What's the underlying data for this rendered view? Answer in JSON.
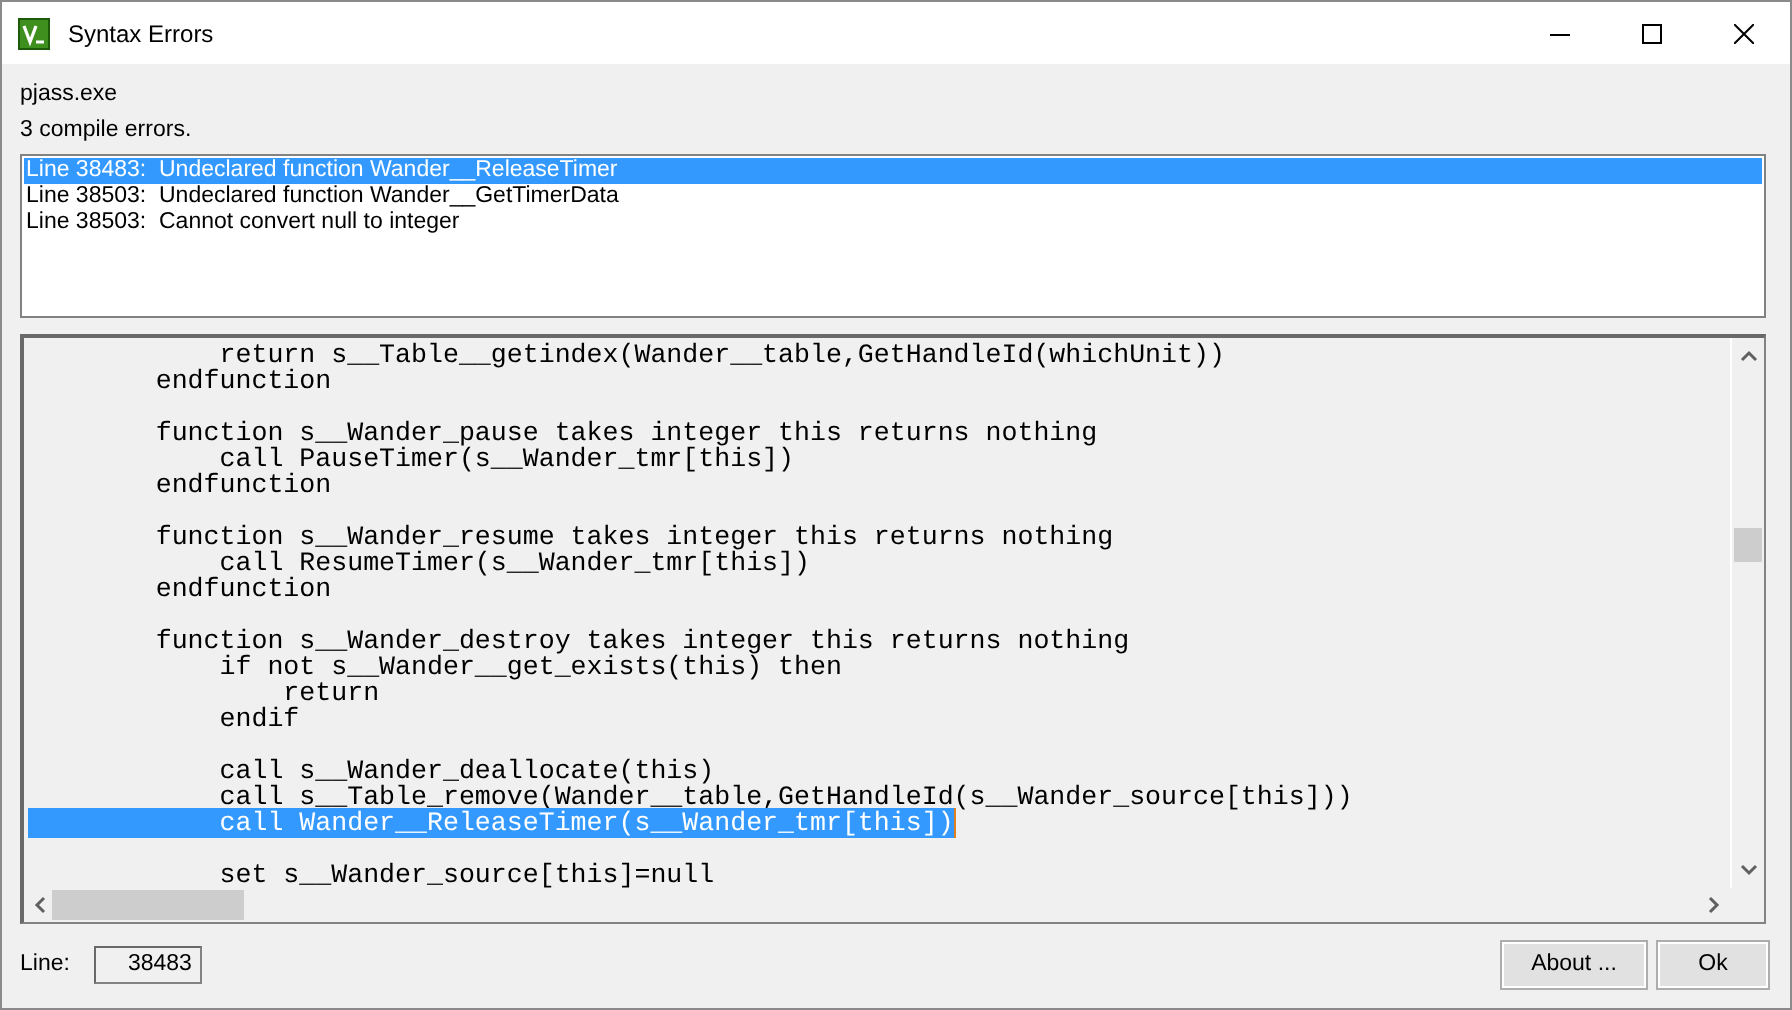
{
  "window": {
    "title": "Syntax Errors"
  },
  "program": "pjass.exe",
  "summary": "3 compile errors.",
  "errors": [
    {
      "text": "Line 38483:  Undeclared function Wander__ReleaseTimer",
      "selected": true
    },
    {
      "text": "Line 38503:  Undeclared function Wander__GetTimerData",
      "selected": false
    },
    {
      "text": "Line 38503:  Cannot convert null to integer",
      "selected": false
    }
  ],
  "code": [
    {
      "kind": "code",
      "text": "            return s__Table__getindex(Wander__table,GetHandleId(whichUnit))",
      "selected": false
    },
    {
      "kind": "code",
      "text": "        endfunction",
      "selected": false
    },
    {
      "kind": "blank"
    },
    {
      "kind": "code",
      "text": "        function s__Wander_pause takes integer this returns nothing",
      "selected": false
    },
    {
      "kind": "code",
      "text": "            call PauseTimer(s__Wander_tmr[this])",
      "selected": false
    },
    {
      "kind": "code",
      "text": "        endfunction",
      "selected": false
    },
    {
      "kind": "blank"
    },
    {
      "kind": "code",
      "text": "        function s__Wander_resume takes integer this returns nothing",
      "selected": false
    },
    {
      "kind": "code",
      "text": "            call ResumeTimer(s__Wander_tmr[this])",
      "selected": false
    },
    {
      "kind": "code",
      "text": "        endfunction",
      "selected": false
    },
    {
      "kind": "blank"
    },
    {
      "kind": "code",
      "text": "        function s__Wander_destroy takes integer this returns nothing",
      "selected": false
    },
    {
      "kind": "code",
      "text": "            if not s__Wander__get_exists(this) then",
      "selected": false
    },
    {
      "kind": "code",
      "text": "                return",
      "selected": false
    },
    {
      "kind": "code",
      "text": "            endif",
      "selected": false
    },
    {
      "kind": "blank"
    },
    {
      "kind": "code",
      "text": "            call s__Wander_deallocate(this)",
      "selected": false
    },
    {
      "kind": "code",
      "text": "            call s__Table_remove(Wander__table,GetHandleId(s__Wander_source[this]))",
      "selected": false
    },
    {
      "kind": "code",
      "text": "            call Wander__ReleaseTimer(s__Wander_tmr[this])",
      "selected": true
    },
    {
      "kind": "blank"
    },
    {
      "kind": "code",
      "text": "            set s__Wander_source[this]=null",
      "selected": false
    }
  ],
  "line_field": {
    "label": "Line:",
    "value": "38483"
  },
  "buttons": [
    "About ...",
    "Ok"
  ]
}
